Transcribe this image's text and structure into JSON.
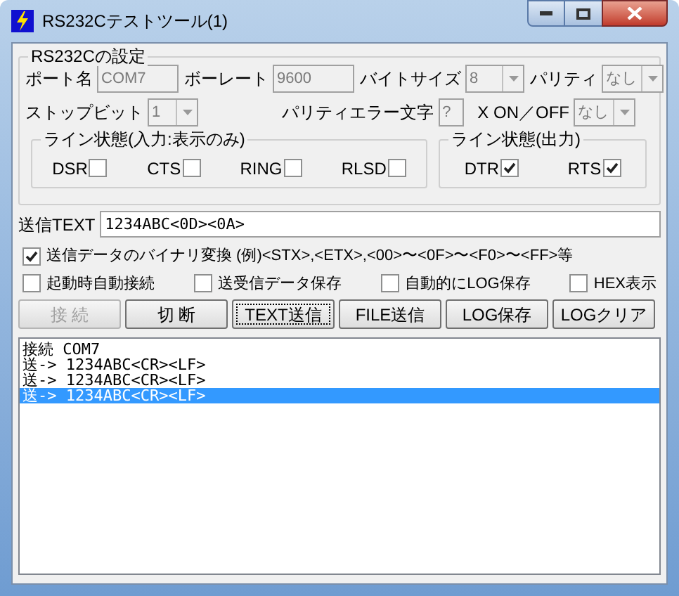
{
  "window": {
    "title": "RS232Cテストツール(1)"
  },
  "settings": {
    "title": "RS232Cの設定",
    "row1": [
      {
        "kind": "text",
        "label": "ポート名",
        "value": "COM7",
        "disabled": true
      },
      {
        "kind": "text",
        "label": "ボーレート",
        "value": "9600",
        "disabled": true
      },
      {
        "kind": "combo",
        "label": "バイトサイズ",
        "value": "8",
        "disabled": true
      },
      {
        "kind": "combo",
        "label": "パリティ",
        "value": "なし",
        "disabled": true
      }
    ],
    "row2": [
      {
        "kind": "combo",
        "label": "ストップビット",
        "value": "1",
        "disabled": true
      },
      {
        "kind": "text",
        "label": "パリティエラー文字",
        "value": "?",
        "disabled": true
      },
      {
        "kind": "combo",
        "label": "X ON／OFF",
        "value": "なし",
        "disabled": true
      }
    ],
    "line_in": {
      "title": "ライン状態(入力:表示のみ)",
      "items": [
        {
          "label": "DSR",
          "checked": false
        },
        {
          "label": "CTS",
          "checked": false
        },
        {
          "label": "RING",
          "checked": false
        },
        {
          "label": "RLSD",
          "checked": false
        }
      ]
    },
    "line_out": {
      "title": "ライン状態(出力)",
      "items": [
        {
          "label": "DTR",
          "checked": true
        },
        {
          "label": "RTS",
          "checked": true
        }
      ]
    }
  },
  "send": {
    "label": "送信TEXT",
    "value": "1234ABC<0D><0A>"
  },
  "options": [
    {
      "label": "送信データのバイナリ変換 (例)<STX>,<ETX>,<00>〜<0F>〜<F0>〜<FF>等",
      "checked": true
    },
    {
      "label": "起動時自動接続",
      "checked": false
    },
    {
      "label": "送受信データ保存",
      "checked": false
    },
    {
      "label": "自動的にLOG保存",
      "checked": false
    },
    {
      "label": "HEX表示",
      "checked": false
    }
  ],
  "buttons": [
    {
      "label": "接 続",
      "disabled": true,
      "focused": false
    },
    {
      "label": "切 断",
      "disabled": false,
      "focused": false
    },
    {
      "label": "TEXT送信",
      "disabled": false,
      "focused": true
    },
    {
      "label": "FILE送信",
      "disabled": false,
      "focused": false
    },
    {
      "label": "LOG保存",
      "disabled": false,
      "focused": false
    },
    {
      "label": "LOGクリア",
      "disabled": false,
      "focused": false
    }
  ],
  "log": [
    {
      "text": "接続 COM7",
      "selected": false
    },
    {
      "text": "送-> 1234ABC<CR><LF>",
      "selected": false
    },
    {
      "text": "送-> 1234ABC<CR><LF>",
      "selected": false
    },
    {
      "text": "送-> 1234ABC<CR><LF>",
      "selected": true
    }
  ]
}
